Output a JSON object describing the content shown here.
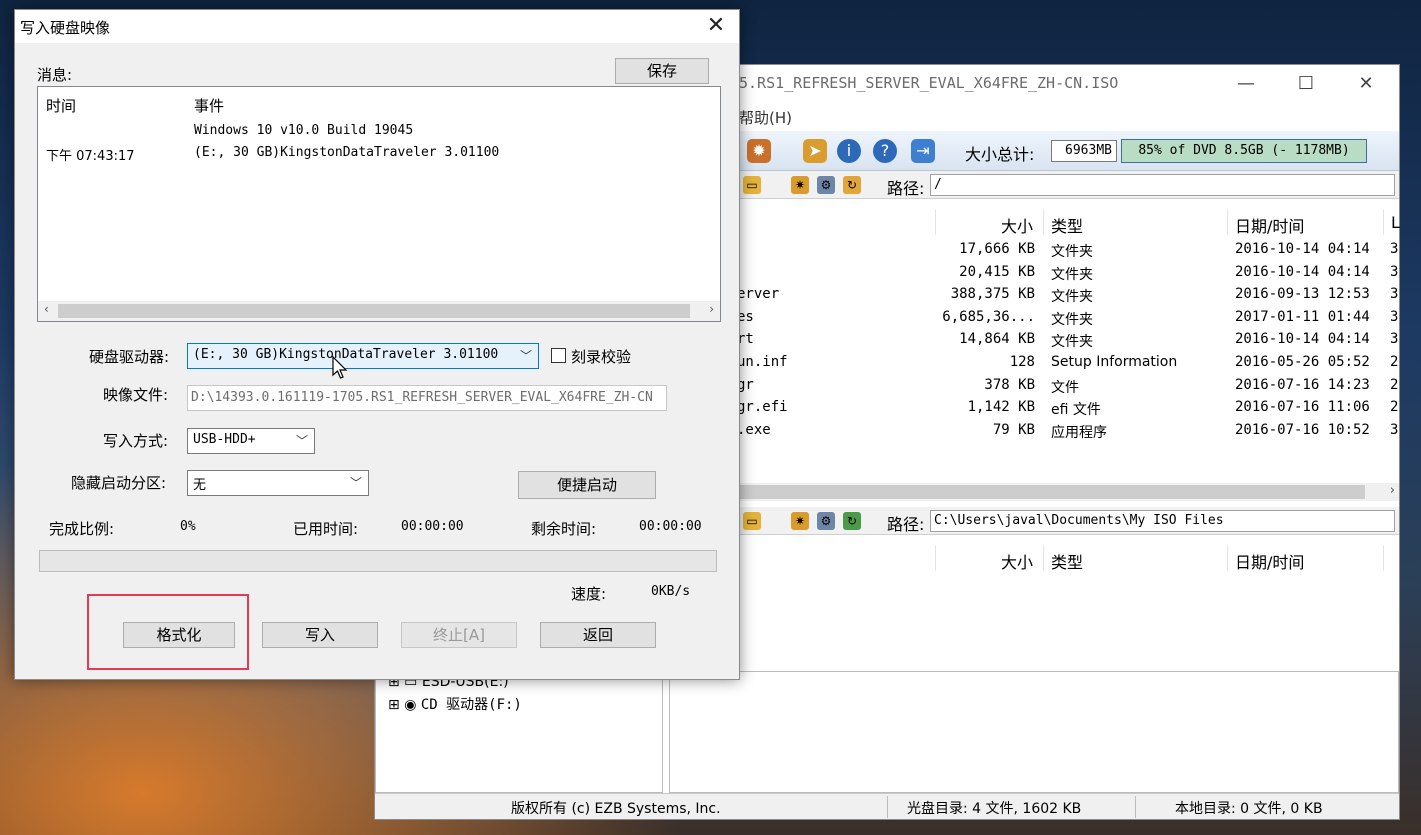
{
  "background_window": {
    "title": "5.RS1_REFRESH_SERVER_EVAL_X64FRE_ZH-CN.ISO",
    "menu_help": "帮助(H)",
    "size_total_label": "大小总计:",
    "size_total_value": "6963MB",
    "capacity_bar_text": "85% of DVD 8.5GB (- 1178MB)",
    "capacity_fraction": 0.85,
    "path_label": "路径:",
    "iso_path": "/",
    "columns": {
      "size": "大小",
      "type": "类型",
      "date": "日期/时间",
      "extra": "L"
    },
    "files": [
      {
        "name": "",
        "size": "17,666 KB",
        "type": "文件夹",
        "date": "2016-10-14 04:14",
        "l": "3"
      },
      {
        "name": "",
        "size": "20,415 KB",
        "type": "文件夹",
        "date": "2016-10-14 04:14",
        "l": "3"
      },
      {
        "name": "erver",
        "size": "388,375 KB",
        "type": "文件夹",
        "date": "2016-09-13 12:53",
        "l": "3"
      },
      {
        "name": "es",
        "size": "6,685,36...",
        "type": "文件夹",
        "date": "2017-01-11 01:44",
        "l": "3"
      },
      {
        "name": "rt",
        "size": "14,864 KB",
        "type": "文件夹",
        "date": "2016-10-14 04:14",
        "l": "3"
      },
      {
        "name": "un.inf",
        "size": "128",
        "type": "Setup Information",
        "date": "2016-05-26 05:52",
        "l": "2"
      },
      {
        "name": "gr",
        "size": "378 KB",
        "type": "文件",
        "date": "2016-07-16 14:23",
        "l": "2"
      },
      {
        "name": "gr.efi",
        "size": "1,142 KB",
        "type": "efi 文件",
        "date": "2016-07-16 11:06",
        "l": "2"
      },
      {
        "name": ".exe",
        "size": "79 KB",
        "type": "应用程序",
        "date": "2016-07-16 10:52",
        "l": "3"
      }
    ],
    "local_path_label": "路径:",
    "local_path": "C:\\Users\\javal\\Documents\\My ISO Files",
    "tree_items": [
      "ESD-USB(E:)",
      "CD 驱动器(F:)"
    ],
    "status": {
      "copyright": "版权所有 (c) EZB Systems, Inc.",
      "disc_dir": "光盘目录: 4 文件, 1602 KB",
      "local_dir": "本地目录: 0 文件, 0 KB"
    }
  },
  "dialog": {
    "title": "写入硬盘映像",
    "close": "✕",
    "messages_label": "消息:",
    "save_button": "保存",
    "col_time": "时间",
    "col_event": "事件",
    "log_line1_event": "Windows 10 v10.0 Build 19045",
    "log_line2_time": "下午 07:43:17",
    "log_line2_event": "(E:, 30 GB)KingstonDataTraveler 3.01100",
    "drive_label": "硬盘驱动器:",
    "drive_value": "(E:, 30 GB)KingstonDataTraveler 3.01100",
    "verify_label": "刻录校验",
    "image_label": "映像文件:",
    "image_value": "D:\\14393.0.161119-1705.RS1_REFRESH_SERVER_EVAL_X64FRE_ZH-CN",
    "write_mode_label": "写入方式:",
    "write_mode_value": "USB-HDD+",
    "hide_partition_label": "隐藏启动分区:",
    "hide_partition_value": "无",
    "quick_boot_button": "便捷启动",
    "done_label": "完成比例:",
    "done_value": "0%",
    "progress_fraction": 0,
    "elapsed_label": "已用时间:",
    "elapsed_value": "00:00:00",
    "remaining_label": "剩余时间:",
    "remaining_value": "00:00:00",
    "speed_label": "速度:",
    "speed_value": "0KB/s",
    "format_button": "格式化",
    "write_button": "写入",
    "stop_button": "终止[A]",
    "back_button": "返回"
  }
}
